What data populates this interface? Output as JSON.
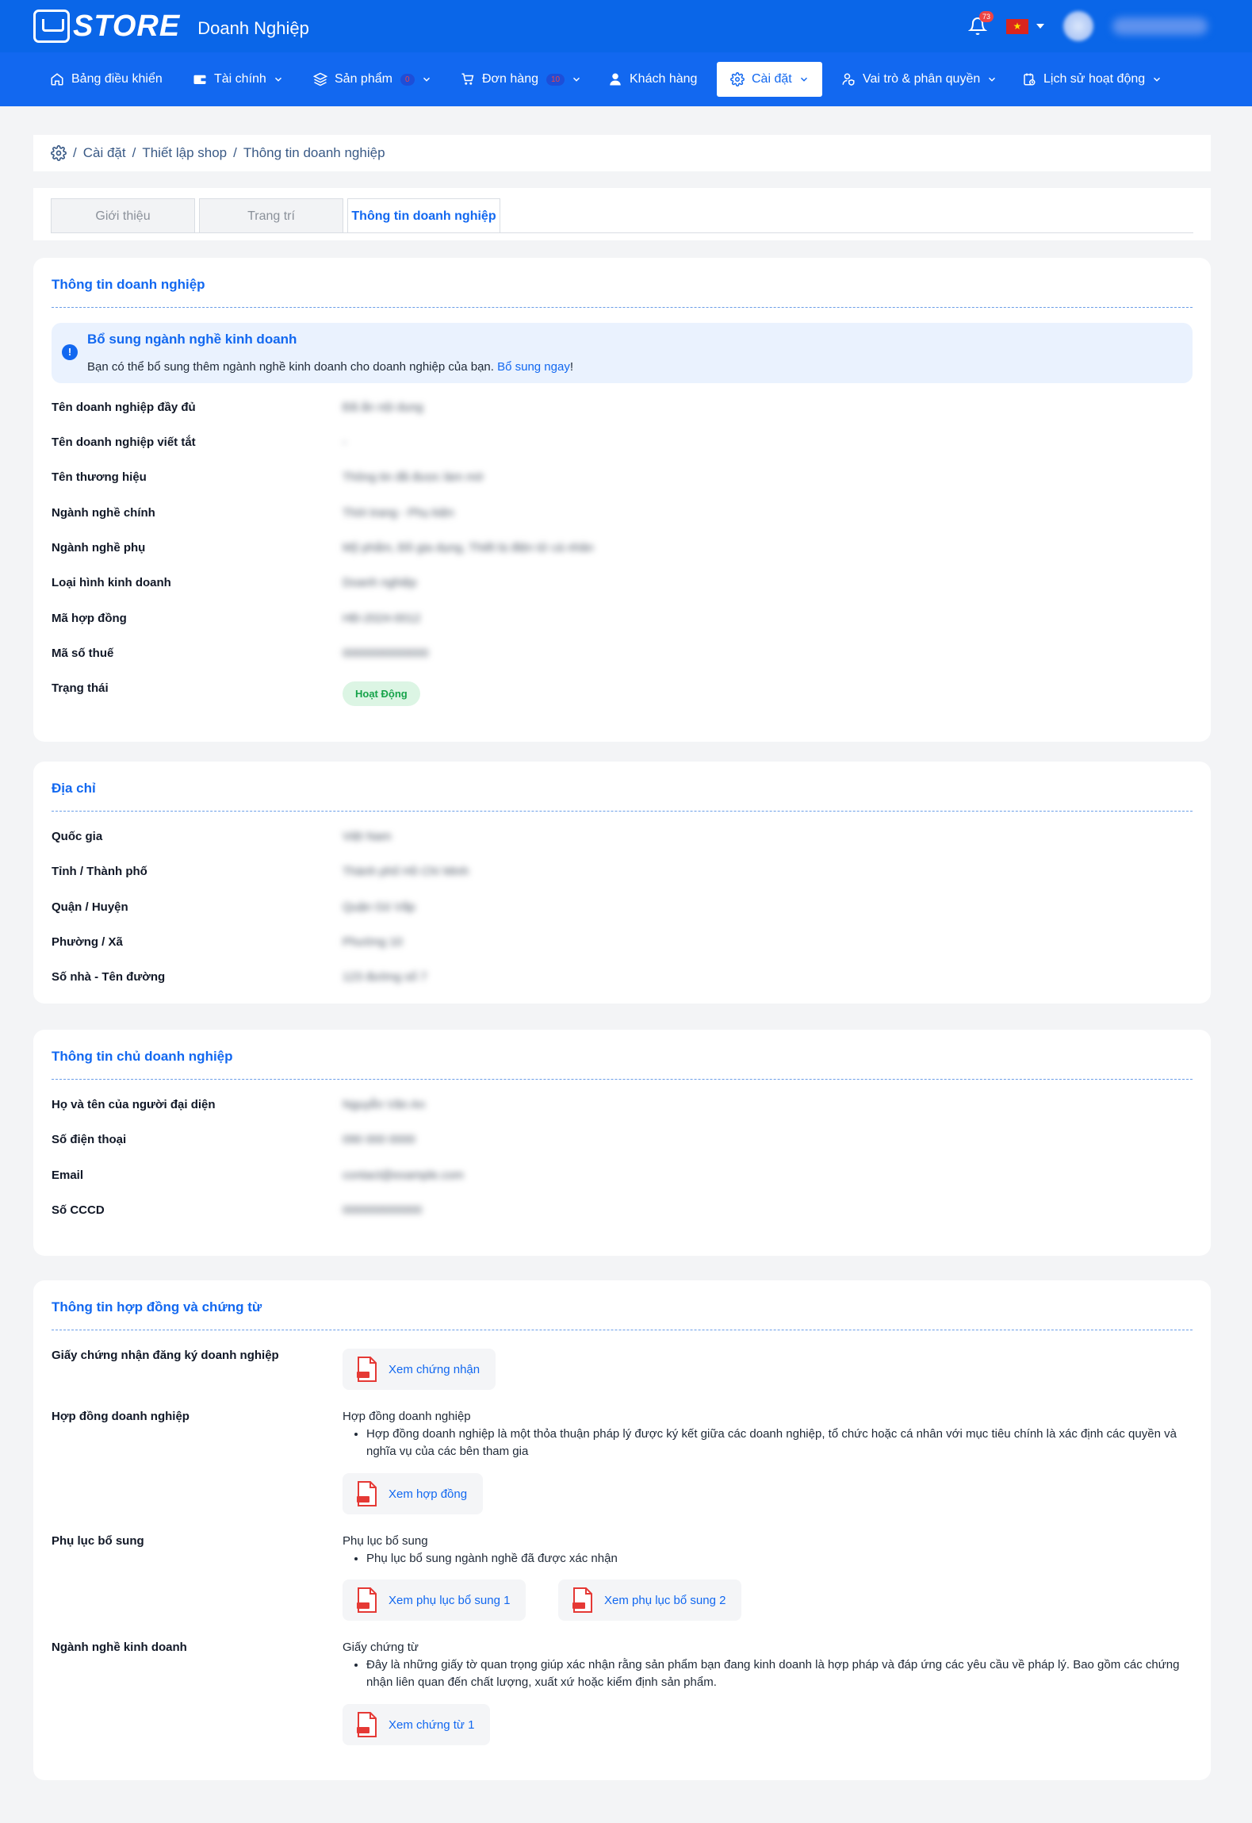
{
  "header": {
    "logo_text": "STORE",
    "app_name": "Doanh Nghiệp",
    "notification_count": "73",
    "flag_symbol": "★"
  },
  "nav": {
    "dashboard": "Bảng điều khiển",
    "finance": "Tài chính",
    "products": "Sản phẩm",
    "products_count": "0",
    "orders": "Đơn hàng",
    "orders_count": "10",
    "customers": "Khách hàng",
    "settings": "Cài đặt",
    "roles": "Vai trò & phân quyền",
    "activity": "Lịch sử hoạt động"
  },
  "breadcrumb": {
    "sep": "/",
    "items": [
      "Cài đặt",
      "Thiết lập shop",
      "Thông tin doanh nghiệp"
    ]
  },
  "tabs": [
    {
      "label": "Giới thiệu",
      "active": false
    },
    {
      "label": "Trang trí",
      "active": false
    },
    {
      "label": "Thông tin doanh nghiệp",
      "active": true
    }
  ],
  "business": {
    "title": "Thông tin doanh nghiệp",
    "notice": {
      "title": "Bổ sung ngành nghề kinh doanh",
      "text": "Bạn có thể bổ sung thêm ngành nghề kinh doanh cho doanh nghiệp của bạn.",
      "link": "Bổ sung ngay",
      "trail": "!"
    },
    "rows": [
      {
        "label": "Tên doanh nghiệp đầy đủ",
        "value": "Đã ẩn nội dung"
      },
      {
        "label": "Tên doanh nghiệp viết tắt",
        "value": "-"
      },
      {
        "label": "Tên thương hiệu",
        "value": "Thông tin đã được làm mờ"
      },
      {
        "label": "Ngành nghề chính",
        "value": "Thời trang - Phụ kiện"
      },
      {
        "label": "Ngành nghề phụ",
        "value": "Mỹ phẩm, Đồ gia dụng, Thiết bị điện tử cá nhân"
      },
      {
        "label": "Loại hình kinh doanh",
        "value": "Doanh nghiệp"
      },
      {
        "label": "Mã hợp đồng",
        "value": "HĐ-2024-0012"
      },
      {
        "label": "Mã số thuế",
        "value": "0000000000000"
      },
      {
        "label": "Trạng thái",
        "value": "Hoạt Động"
      }
    ]
  },
  "address": {
    "title": "Địa chỉ",
    "rows": [
      {
        "label": "Quốc gia",
        "value": "Việt Nam"
      },
      {
        "label": "Tỉnh / Thành phố",
        "value": "Thành phố Hồ Chí Minh"
      },
      {
        "label": "Quận / Huyện",
        "value": "Quận Gò Vấp"
      },
      {
        "label": "Phường / Xã",
        "value": "Phường 10"
      },
      {
        "label": "Số nhà - Tên đường",
        "value": "123 đường số 7"
      }
    ]
  },
  "owner": {
    "title": "Thông tin chủ doanh nghiệp",
    "rows": [
      {
        "label": "Họ và tên của người đại diện",
        "value": "Nguyễn Văn An"
      },
      {
        "label": "Số điện thoại",
        "value": "090 000 0000"
      },
      {
        "label": "Email",
        "value": "contact@example.com"
      },
      {
        "label": "Số CCCD",
        "value": "000000000000"
      }
    ]
  },
  "contract": {
    "title": "Thông tin hợp đồng và chứng từ",
    "cert_label": "Giấy chứng nhận đăng ký doanh nghiệp",
    "cert_btn": "Xem chứng nhận",
    "contract_label": "Hợp đồng doanh nghiệp",
    "contract_title": "Hợp đồng doanh nghiệp",
    "contract_desc": "Hợp đồng doanh nghiệp là một thỏa thuận pháp lý được ký kết giữa các doanh nghiệp, tổ chức hoặc cá nhân với mục tiêu chính là xác định các quyền và nghĩa vụ của các bên tham gia",
    "contract_btn": "Xem hợp đồng",
    "appendix_label": "Phụ lục bổ sung",
    "appendix_title": "Phụ lục bổ sung",
    "appendix_desc": "Phụ lục bổ sung ngành nghề đã được xác nhận",
    "appendix_btn_1": "Xem phụ lục bổ sung 1",
    "appendix_btn_2": "Xem phụ lục bổ sung 2",
    "industry_label": "Ngành nghề kinh doanh",
    "industry_title": "Giấy chứng từ",
    "industry_desc": "Đây là những giấy tờ quan trọng giúp xác nhận rằng sản phẩm bạn đang kinh doanh là hợp pháp và đáp ứng các yêu cầu về pháp lý. Bao gồm các chứng nhận liên quan đến chất lượng, xuất xứ hoặc kiểm định sản phẩm.",
    "industry_btn": "Xem chứng từ 1"
  },
  "colors": {
    "primary": "#1268f0",
    "header": "#0a66e8",
    "status_bg": "#dcf5e4",
    "status_text": "#16a34a",
    "pdf_red": "#e53935"
  },
  "icons": [
    "home-icon",
    "wallet-icon",
    "layers-icon",
    "cart-icon",
    "user-icon",
    "gear-icon",
    "user-shield-icon",
    "history-icon",
    "bell-icon",
    "info-icon",
    "pdf-icon",
    "chevron-down-icon"
  ]
}
